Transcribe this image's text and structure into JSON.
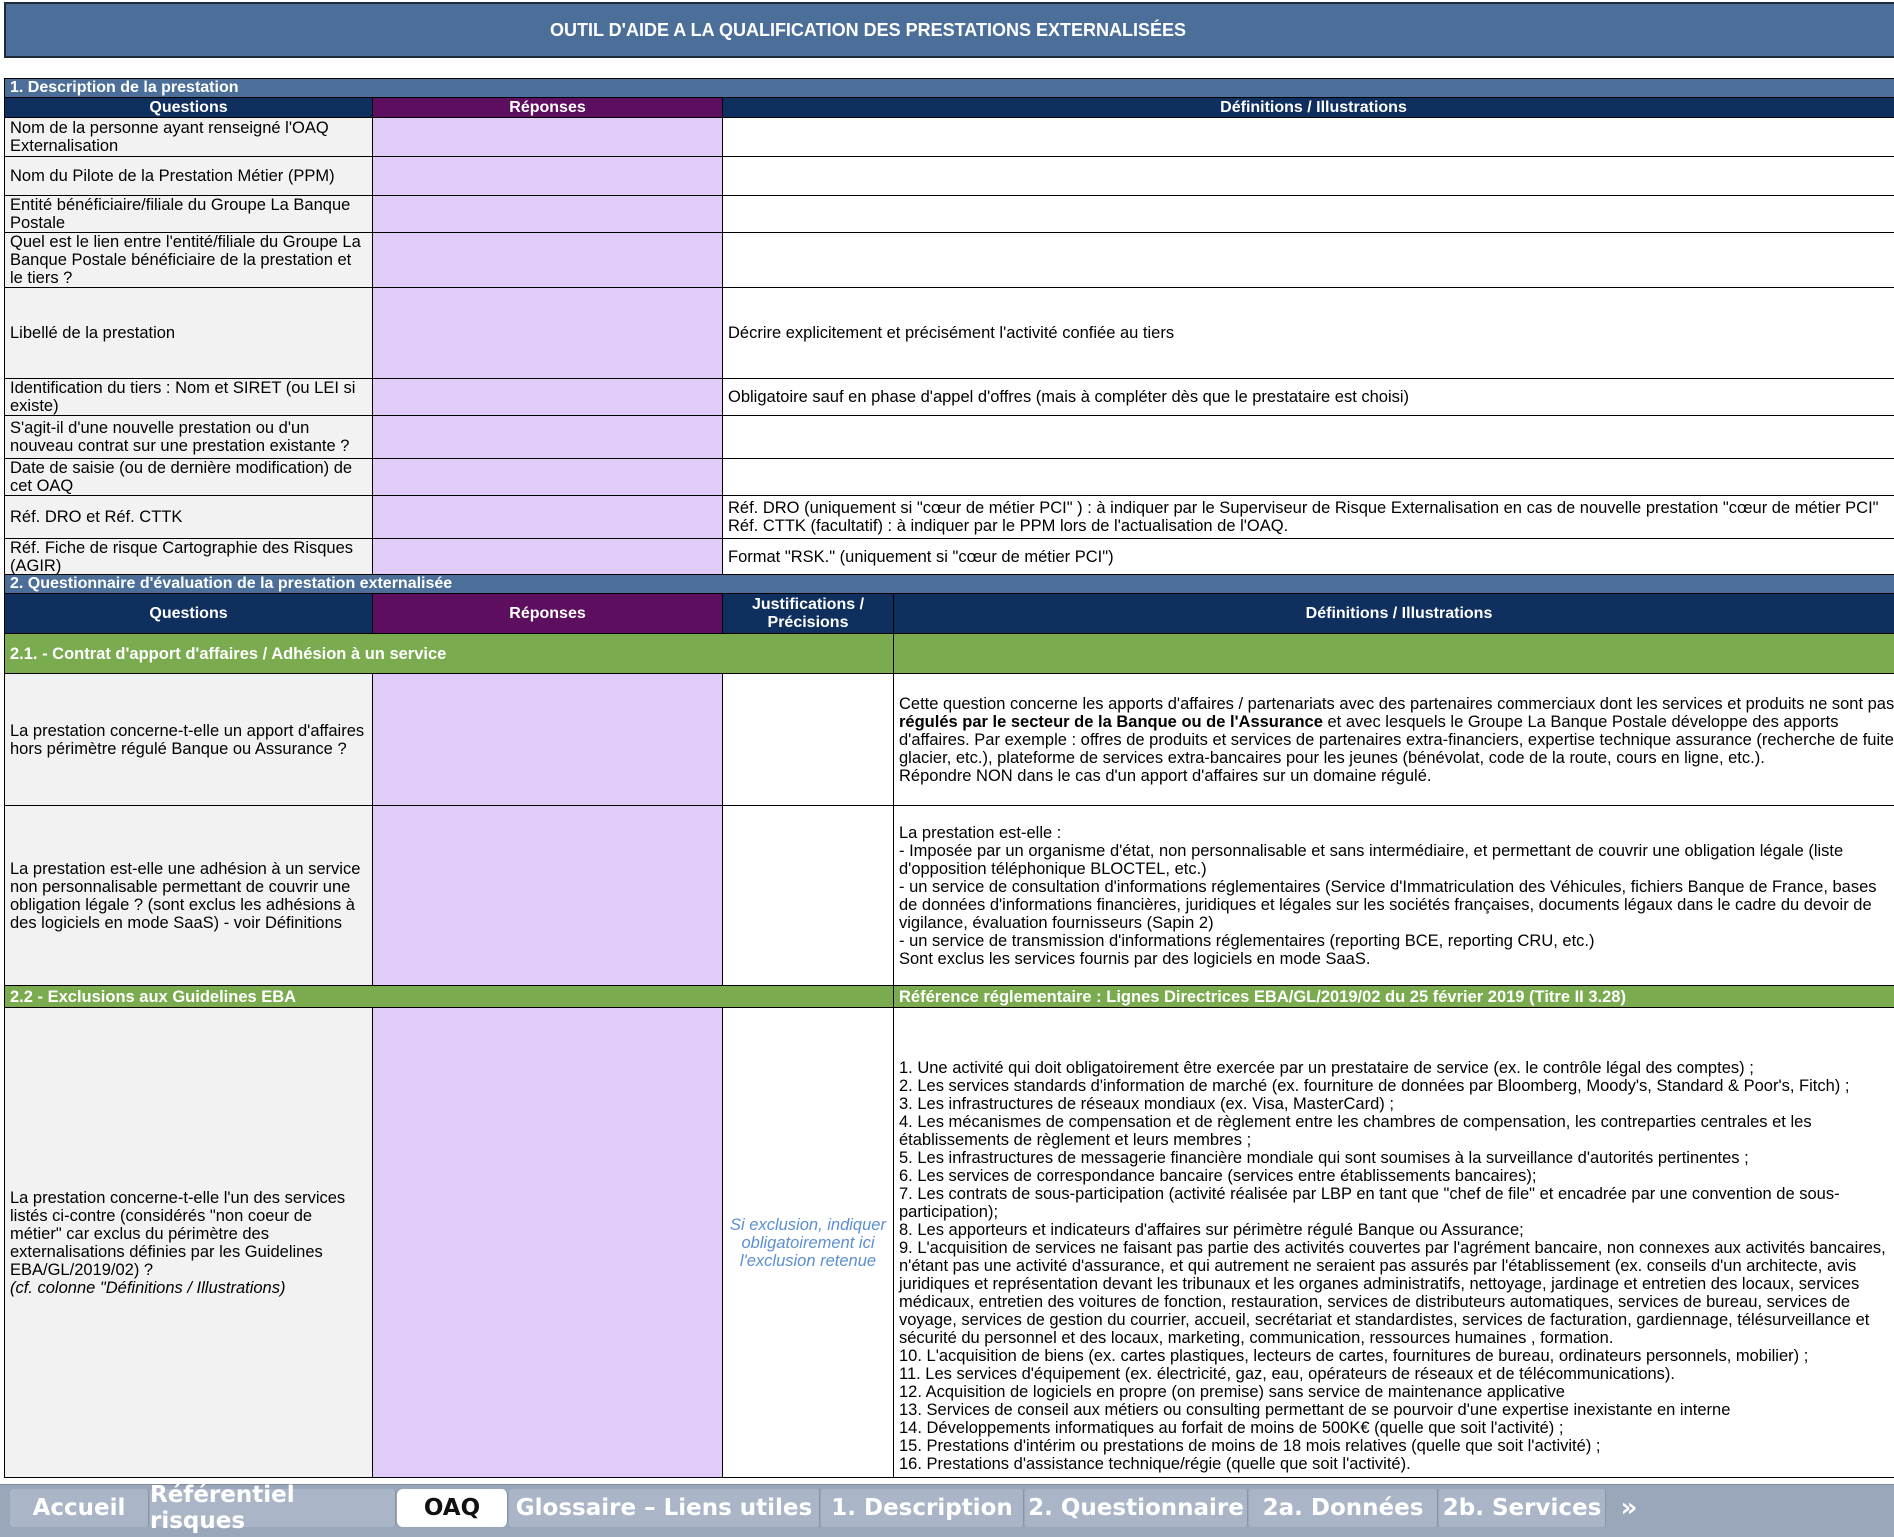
{
  "title": "OUTIL D'AIDE A LA QUALIFICATION DES PRESTATIONS EXTERNALISÉES",
  "section1": {
    "title": "1. Description de la prestation",
    "headers": [
      "Questions",
      "Réponses",
      "Définitions / Illustrations"
    ],
    "rows": [
      {
        "q": "Nom de la personne ayant renseigné l'OAQ Externalisation",
        "d": ""
      },
      {
        "q": "Nom du Pilote de la Prestation Métier (PPM)",
        "d": ""
      },
      {
        "q": "Entité bénéficiaire/filiale du Groupe La Banque Postale",
        "d": ""
      },
      {
        "q": "Quel est le lien entre l'entité/filiale du Groupe La Banque Postale bénéficiaire de la prestation et le tiers ?",
        "d": ""
      },
      {
        "q": "Libellé de la prestation",
        "d": "Décrire explicitement et précisément l'activité confiée au tiers"
      },
      {
        "q": "Identification du tiers : Nom et SIRET (ou LEI si existe)",
        "d": "Obligatoire sauf en phase d'appel d'offres (mais à compléter dès que le prestataire est choisi)"
      },
      {
        "q": "S'agit-il d'une nouvelle prestation ou d'un nouveau contrat sur une prestation existante ?",
        "d": ""
      },
      {
        "q": "Date de saisie (ou de dernière modification) de cet OAQ",
        "d": ""
      },
      {
        "q": "Réf. DRO et Réf. CTTK",
        "d": "Réf. DRO (uniquement si \"cœur de métier PCI\" ) : à indiquer par le Superviseur de Risque Externalisation en cas de nouvelle prestation \"cœur de métier PCI\"\nRéf. CTTK (facultatif) : à indiquer par le PPM lors de l'actualisation de l'OAQ."
      },
      {
        "q": "Réf. Fiche de risque Cartographie des Risques (AGIR)",
        "d": "Format \"RSK.\" (uniquement si \"cœur de métier PCI\")"
      }
    ]
  },
  "section2": {
    "title": "2. Questionnaire d'évaluation de la prestation externalisée",
    "headers": [
      "Questions",
      "Réponses",
      "Justifications / Précisions",
      "Définitions / Illustrations"
    ],
    "sub1": {
      "title": "2.1. - Contrat d'apport d'affaires /  Adhésion à un service",
      "q1": "La prestation concerne-t-elle un apport d'affaires hors périmètre régulé Banque ou Assurance ?",
      "d1_a": "Cette question concerne les apports d'affaires / partenariats avec des partenaires commerciaux dont les services et produits ne sont pas ",
      "d1_b": "régulés par le secteur de la Banque ou de l'Assurance",
      "d1_c": " et avec lesquels le Groupe La Banque Postale développe des apports d'affaires. Par exemple : offres de produits et services de partenaires extra-financiers, expertise technique assurance (recherche de fuite, glacier, etc.), plateforme de services extra-bancaires pour les jeunes (bénévolat, code de la route, cours en ligne, etc.).\nRépondre NON dans le cas d'un apport d'affaires sur un domaine régulé.",
      "q2": "La prestation est-elle une adhésion à un service non personnalisable permettant de couvrir une obligation légale ? (sont exclus les adhésions à des logiciels en mode SaaS) - voir Définitions",
      "d2": "La prestation est-elle :\n- Imposée par un organisme d'état, non personnalisable et sans intermédiaire, et permettant de couvrir une obligation légale (liste d'opposition téléphonique BLOCTEL, etc.)\n- un service de consultation d'informations réglementaires (Service d'Immatriculation des Véhicules, fichiers Banque de France, bases de données d'informations financières, juridiques et légales sur les sociétés françaises, documents légaux dans le cadre du devoir de vigilance, évaluation fournisseurs (Sapin 2)\n- un service de transmission d'informations réglementaires (reporting BCE, reporting CRU, etc.)\nSont exclus les services fournis par des logiciels en mode SaaS."
    },
    "sub2": {
      "title": "2.2 - Exclusions aux Guidelines EBA",
      "ref": "Référence réglementaire : Lignes Directrices EBA/GL/2019/02 du 25 février 2019 (Titre II 3.28)",
      "q": "La prestation concerne-t-elle l'un des services listés ci-contre (considérés \"non coeur de métier\" car exclus du périmètre des externalisations définies par les Guidelines EBA/GL/2019/02) ?",
      "q_note": "(cf. colonne \"Définitions / Illustrations)",
      "just": "Si exclusion, indiquer obligatoirement ici l'exclusion retenue",
      "d": "1. Une activité qui doit obligatoirement être exercée par un prestataire de service (ex. le contrôle légal des comptes) ;\n2. Les services standards d'information de marché (ex. fourniture de données par Bloomberg, Moody's, Standard & Poor's, Fitch) ;\n3. Les infrastructures de réseaux mondiaux (ex. Visa, MasterCard) ;\n4. Les mécanismes de compensation et de règlement entre les chambres de compensation, les contreparties centrales et les établissements de règlement et leurs membres ;\n5. Les infrastructures de messagerie financière mondiale qui sont soumises à la surveillance d'autorités pertinentes ;\n6. Les services de correspondance bancaire (services entre établissements bancaires);\n7. Les contrats de sous-participation (activité réalisée par LBP en tant que \"chef de file\" et encadrée par une convention de sous-participation);\n8. Les apporteurs et indicateurs d'affaires sur périmètre régulé Banque ou Assurance;\n9. L'acquisition de services ne faisant pas partie des activités couvertes par l'agrément bancaire, non connexes aux activités bancaires, n'étant pas une activité d'assurance, et qui autrement ne seraient pas assurés par l'établissement (ex. conseils d'un architecte, avis juridiques et représentation devant les tribunaux et les organes administratifs, nettoyage, jardinage et entretien des locaux, services médicaux, entretien des voitures de fonction, restauration, services de distributeurs automatiques, services de bureau, services de voyage, services de gestion du courrier, accueil, secrétariat et standardistes, services de facturation, gardiennage, télésurveillance et sécurité du personnel et des locaux, marketing, communication, ressources humaines , formation.\n10. L'acquisition de biens (ex. cartes plastiques, lecteurs de cartes, fournitures de bureau, ordinateurs personnels, mobilier) ;\n11. Les services d'équipement (ex. électricité, gaz, eau, opérateurs de réseaux et de télécommunications).\n12. Acquisition de logiciels en propre (on premise) sans service de maintenance applicative\n13. Services de conseil aux métiers ou consulting permettant de se pourvoir d'une expertise inexistante en interne\n14. Développements informatiques au forfait de moins de 500K€ (quelle que soit l'activité) ;\n15. Prestations d'intérim ou prestations de moins de 18 mois relatives (quelle que soit l'activité) ;\n16. Prestations d'assistance technique/régie (quelle que soit l'activité)."
    }
  },
  "tabs": [
    "Accueil",
    "Référentiel risques",
    "OAQ",
    "Glossaire – Liens utiles",
    "1. Description",
    "2. Questionnaire",
    "2a. Données",
    "2b. Services"
  ],
  "active_tab": "OAQ",
  "more_tabs_icon": "double-chevron-right"
}
